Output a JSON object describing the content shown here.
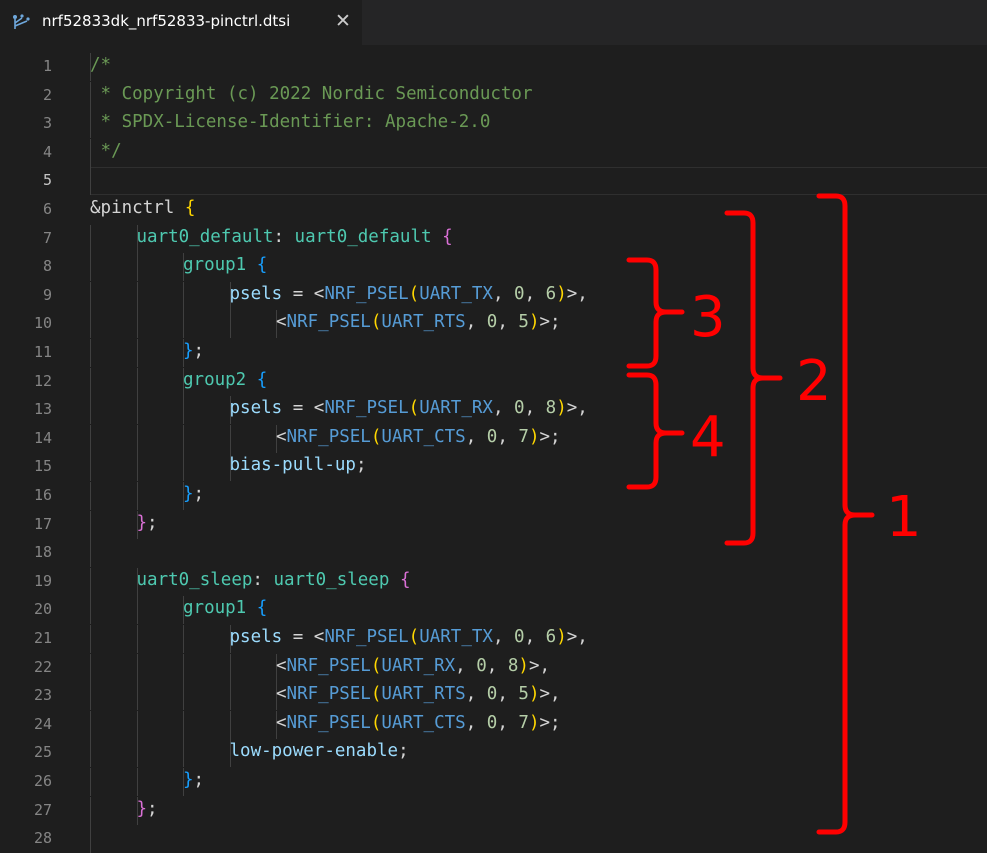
{
  "tab": {
    "title": "nrf52833dk_nrf52833-pinctrl.dtsi",
    "close_glyph": "✕",
    "icon": "devicetree-file-icon"
  },
  "editor": {
    "current_line": 5,
    "lines": [
      {
        "n": "1",
        "indent": 0,
        "tokens": [
          {
            "t": "/*",
            "c": "comment"
          }
        ]
      },
      {
        "n": "2",
        "indent": 0,
        "tokens": [
          {
            "t": " * Copyright (c) 2022 Nordic Semiconductor",
            "c": "comment"
          }
        ]
      },
      {
        "n": "3",
        "indent": 0,
        "tokens": [
          {
            "t": " * SPDX-License-Identifier: Apache-2.0",
            "c": "comment"
          }
        ]
      },
      {
        "n": "4",
        "indent": 0,
        "tokens": [
          {
            "t": " */",
            "c": "comment"
          }
        ]
      },
      {
        "n": "5",
        "indent": 0,
        "tokens": []
      },
      {
        "n": "6",
        "indent": 0,
        "tokens": [
          {
            "t": "&",
            "c": "punct"
          },
          {
            "t": "pinctrl",
            "c": "punct"
          },
          {
            "t": " ",
            "c": "punct"
          },
          {
            "t": "{",
            "c": "b1"
          }
        ]
      },
      {
        "n": "7",
        "indent": 1,
        "tokens": [
          {
            "t": "uart0_default",
            "c": "node"
          },
          {
            "t": ": ",
            "c": "punct"
          },
          {
            "t": "uart0_default",
            "c": "node"
          },
          {
            "t": " ",
            "c": "punct"
          },
          {
            "t": "{",
            "c": "b2"
          }
        ]
      },
      {
        "n": "8",
        "indent": 2,
        "tokens": [
          {
            "t": "group1",
            "c": "node"
          },
          {
            "t": " ",
            "c": "punct"
          },
          {
            "t": "{",
            "c": "b3"
          }
        ]
      },
      {
        "n": "9",
        "indent": 3,
        "tokens": [
          {
            "t": "psels",
            "c": "prop"
          },
          {
            "t": " = <",
            "c": "punct"
          },
          {
            "t": "NRF_PSEL",
            "c": "macro"
          },
          {
            "t": "(",
            "c": "b1"
          },
          {
            "t": "UART_TX",
            "c": "macro"
          },
          {
            "t": ", ",
            "c": "punct"
          },
          {
            "t": "0",
            "c": "num"
          },
          {
            "t": ", ",
            "c": "punct"
          },
          {
            "t": "6",
            "c": "num"
          },
          {
            "t": ")",
            "c": "b1"
          },
          {
            "t": ">,",
            "c": "punct"
          }
        ]
      },
      {
        "n": "10",
        "indent": 4,
        "tokens": [
          {
            "t": "<",
            "c": "punct"
          },
          {
            "t": "NRF_PSEL",
            "c": "macro"
          },
          {
            "t": "(",
            "c": "b1"
          },
          {
            "t": "UART_RTS",
            "c": "macro"
          },
          {
            "t": ", ",
            "c": "punct"
          },
          {
            "t": "0",
            "c": "num"
          },
          {
            "t": ", ",
            "c": "punct"
          },
          {
            "t": "5",
            "c": "num"
          },
          {
            "t": ")",
            "c": "b1"
          },
          {
            "t": ">;",
            "c": "punct"
          }
        ]
      },
      {
        "n": "11",
        "indent": 2,
        "tokens": [
          {
            "t": "}",
            "c": "b3"
          },
          {
            "t": ";",
            "c": "punct"
          }
        ]
      },
      {
        "n": "12",
        "indent": 2,
        "tokens": [
          {
            "t": "group2",
            "c": "node"
          },
          {
            "t": " ",
            "c": "punct"
          },
          {
            "t": "{",
            "c": "b3"
          }
        ]
      },
      {
        "n": "13",
        "indent": 3,
        "tokens": [
          {
            "t": "psels",
            "c": "prop"
          },
          {
            "t": " = <",
            "c": "punct"
          },
          {
            "t": "NRF_PSEL",
            "c": "macro"
          },
          {
            "t": "(",
            "c": "b1"
          },
          {
            "t": "UART_RX",
            "c": "macro"
          },
          {
            "t": ", ",
            "c": "punct"
          },
          {
            "t": "0",
            "c": "num"
          },
          {
            "t": ", ",
            "c": "punct"
          },
          {
            "t": "8",
            "c": "num"
          },
          {
            "t": ")",
            "c": "b1"
          },
          {
            "t": ">,",
            "c": "punct"
          }
        ]
      },
      {
        "n": "14",
        "indent": 4,
        "tokens": [
          {
            "t": "<",
            "c": "punct"
          },
          {
            "t": "NRF_PSEL",
            "c": "macro"
          },
          {
            "t": "(",
            "c": "b1"
          },
          {
            "t": "UART_CTS",
            "c": "macro"
          },
          {
            "t": ", ",
            "c": "punct"
          },
          {
            "t": "0",
            "c": "num"
          },
          {
            "t": ", ",
            "c": "punct"
          },
          {
            "t": "7",
            "c": "num"
          },
          {
            "t": ")",
            "c": "b1"
          },
          {
            "t": ">;",
            "c": "punct"
          }
        ]
      },
      {
        "n": "15",
        "indent": 3,
        "tokens": [
          {
            "t": "bias-pull-up",
            "c": "prop"
          },
          {
            "t": ";",
            "c": "punct"
          }
        ]
      },
      {
        "n": "16",
        "indent": 2,
        "tokens": [
          {
            "t": "}",
            "c": "b3"
          },
          {
            "t": ";",
            "c": "punct"
          }
        ]
      },
      {
        "n": "17",
        "indent": 1,
        "tokens": [
          {
            "t": "}",
            "c": "b2"
          },
          {
            "t": ";",
            "c": "punct"
          }
        ]
      },
      {
        "n": "18",
        "indent": 0,
        "tokens": []
      },
      {
        "n": "19",
        "indent": 1,
        "tokens": [
          {
            "t": "uart0_sleep",
            "c": "node"
          },
          {
            "t": ": ",
            "c": "punct"
          },
          {
            "t": "uart0_sleep",
            "c": "node"
          },
          {
            "t": " ",
            "c": "punct"
          },
          {
            "t": "{",
            "c": "b2"
          }
        ]
      },
      {
        "n": "20",
        "indent": 2,
        "tokens": [
          {
            "t": "group1",
            "c": "node"
          },
          {
            "t": " ",
            "c": "punct"
          },
          {
            "t": "{",
            "c": "b3"
          }
        ]
      },
      {
        "n": "21",
        "indent": 3,
        "tokens": [
          {
            "t": "psels",
            "c": "prop"
          },
          {
            "t": " = <",
            "c": "punct"
          },
          {
            "t": "NRF_PSEL",
            "c": "macro"
          },
          {
            "t": "(",
            "c": "b1"
          },
          {
            "t": "UART_TX",
            "c": "macro"
          },
          {
            "t": ", ",
            "c": "punct"
          },
          {
            "t": "0",
            "c": "num"
          },
          {
            "t": ", ",
            "c": "punct"
          },
          {
            "t": "6",
            "c": "num"
          },
          {
            "t": ")",
            "c": "b1"
          },
          {
            "t": ">,",
            "c": "punct"
          }
        ]
      },
      {
        "n": "22",
        "indent": 4,
        "tokens": [
          {
            "t": "<",
            "c": "punct"
          },
          {
            "t": "NRF_PSEL",
            "c": "macro"
          },
          {
            "t": "(",
            "c": "b1"
          },
          {
            "t": "UART_RX",
            "c": "macro"
          },
          {
            "t": ", ",
            "c": "punct"
          },
          {
            "t": "0",
            "c": "num"
          },
          {
            "t": ", ",
            "c": "punct"
          },
          {
            "t": "8",
            "c": "num"
          },
          {
            "t": ")",
            "c": "b1"
          },
          {
            "t": ">,",
            "c": "punct"
          }
        ]
      },
      {
        "n": "23",
        "indent": 4,
        "tokens": [
          {
            "t": "<",
            "c": "punct"
          },
          {
            "t": "NRF_PSEL",
            "c": "macro"
          },
          {
            "t": "(",
            "c": "b1"
          },
          {
            "t": "UART_RTS",
            "c": "macro"
          },
          {
            "t": ", ",
            "c": "punct"
          },
          {
            "t": "0",
            "c": "num"
          },
          {
            "t": ", ",
            "c": "punct"
          },
          {
            "t": "5",
            "c": "num"
          },
          {
            "t": ")",
            "c": "b1"
          },
          {
            "t": ">,",
            "c": "punct"
          }
        ]
      },
      {
        "n": "24",
        "indent": 4,
        "tokens": [
          {
            "t": "<",
            "c": "punct"
          },
          {
            "t": "NRF_PSEL",
            "c": "macro"
          },
          {
            "t": "(",
            "c": "b1"
          },
          {
            "t": "UART_CTS",
            "c": "macro"
          },
          {
            "t": ", ",
            "c": "punct"
          },
          {
            "t": "0",
            "c": "num"
          },
          {
            "t": ", ",
            "c": "punct"
          },
          {
            "t": "7",
            "c": "num"
          },
          {
            "t": ")",
            "c": "b1"
          },
          {
            "t": ">;",
            "c": "punct"
          }
        ]
      },
      {
        "n": "25",
        "indent": 3,
        "tokens": [
          {
            "t": "low-power-enable",
            "c": "prop"
          },
          {
            "t": ";",
            "c": "punct"
          }
        ]
      },
      {
        "n": "26",
        "indent": 2,
        "tokens": [
          {
            "t": "}",
            "c": "b3"
          },
          {
            "t": ";",
            "c": "punct"
          }
        ]
      },
      {
        "n": "27",
        "indent": 1,
        "tokens": [
          {
            "t": "}",
            "c": "b2"
          },
          {
            "t": ";",
            "c": "punct"
          }
        ]
      },
      {
        "n": "28",
        "indent": 0,
        "tokens": []
      }
    ]
  },
  "annotations": {
    "color": "#ff0000",
    "brackets": [
      {
        "label": "1",
        "from_line": "6",
        "to_line": "28"
      },
      {
        "label": "2",
        "from_line": "7",
        "to_line": "17"
      },
      {
        "label": "3",
        "from_line": "8",
        "to_line": "11"
      },
      {
        "label": "4",
        "from_line": "12",
        "to_line": "16"
      }
    ]
  }
}
